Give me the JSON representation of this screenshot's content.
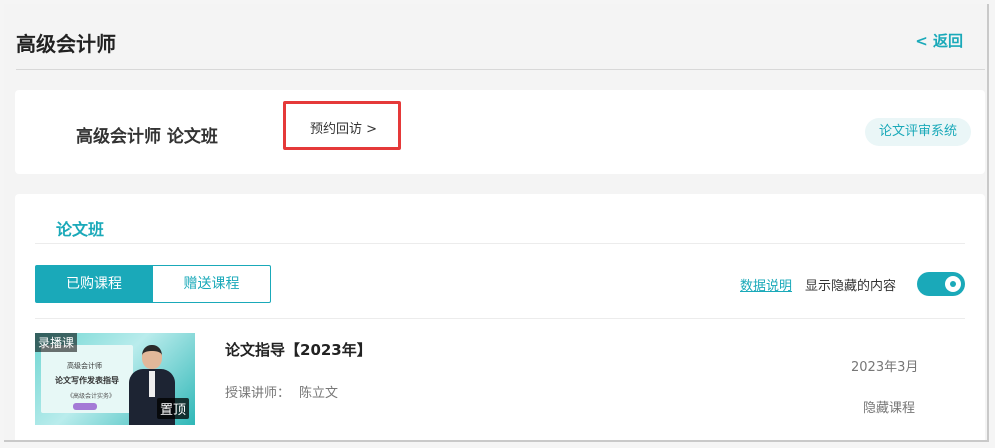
{
  "header": {
    "title": "高级会计师",
    "back_label": "< 返回"
  },
  "course_card": {
    "name": "高级会计师 论文班",
    "appointment_label": "预约回访 >",
    "review_system_label": "论文评审系统"
  },
  "section": {
    "title": "论文班",
    "tabs": [
      {
        "label": "已购课程",
        "active": true
      },
      {
        "label": "赠送课程",
        "active": false
      }
    ],
    "data_link_label": "数据说明",
    "show_hidden_label": "显示隐藏的内容",
    "show_hidden_enabled": true
  },
  "lessons": [
    {
      "title": "论文指导【2023年】",
      "lecturer_label": "授课讲师：",
      "lecturer_name": "陈立文",
      "date": "2023年3月",
      "status": "隐藏课程",
      "thumbnail": {
        "recorded_badge": "录播课",
        "pin_badge": "置顶",
        "line1": "高级会计师",
        "line2": "论文写作发表指导",
        "line3": "《高级会计实务》"
      }
    }
  ],
  "colors": {
    "accent": "#1aa9b9",
    "highlight_border": "#e53939"
  }
}
